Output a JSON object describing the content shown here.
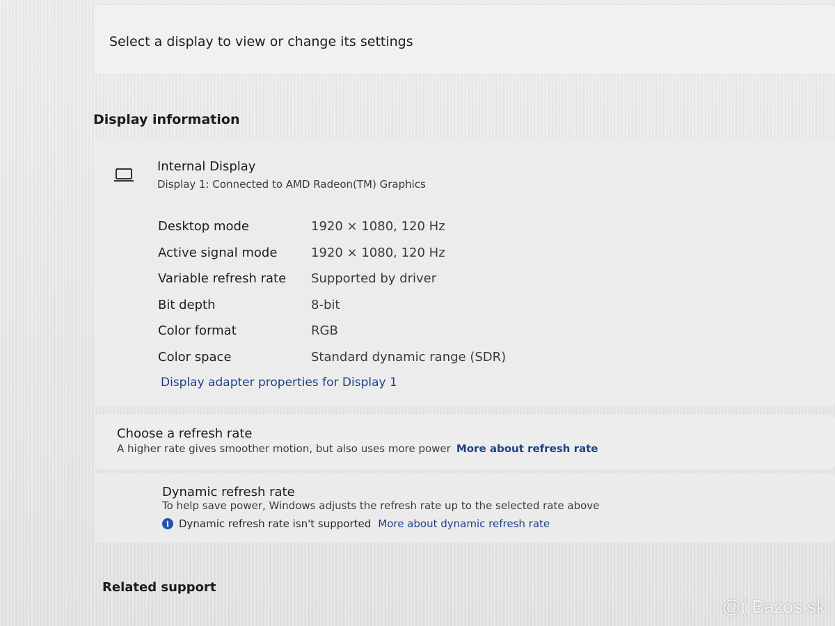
{
  "header": {
    "select_display_text": "Select a display to view or change its settings"
  },
  "display_information": {
    "section_title": "Display information",
    "display_icon": "monitor-icon",
    "display_name": "Internal Display",
    "display_subtitle": "Display 1: Connected to AMD Radeon(TM) Graphics",
    "properties": [
      {
        "label": "Desktop mode",
        "value": "1920 × 1080, 120 Hz"
      },
      {
        "label": "Active signal mode",
        "value": "1920 × 1080, 120 Hz"
      },
      {
        "label": "Variable refresh rate",
        "value": "Supported by driver"
      },
      {
        "label": "Bit depth",
        "value": "8-bit"
      },
      {
        "label": "Color format",
        "value": "RGB"
      },
      {
        "label": "Color space",
        "value": "Standard dynamic range (SDR)"
      }
    ],
    "adapter_link": "Display adapter properties for Display 1"
  },
  "refresh_rate": {
    "title": "Choose a refresh rate",
    "description": "A higher rate gives smoother motion, but also uses more power",
    "link": "More about refresh rate"
  },
  "dynamic_refresh": {
    "title": "Dynamic refresh rate",
    "description": "To help save power, Windows adjusts the refresh rate up to the selected rate above",
    "status_icon": "info-icon",
    "status_text": "Dynamic refresh rate isn't supported",
    "link": "More about dynamic refresh rate"
  },
  "related_support": {
    "title": "Related support"
  },
  "watermark": "@( Bazos.sk",
  "colors": {
    "link": "#1c3f8a",
    "info_icon": "#2350b4"
  }
}
